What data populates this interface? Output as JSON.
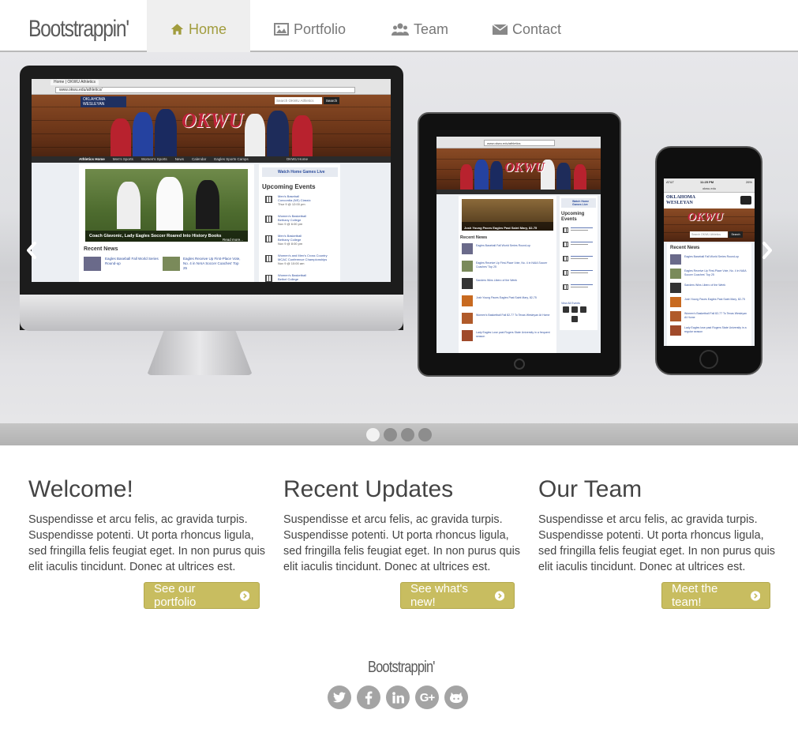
{
  "brand": "Bootstrappin'",
  "nav": {
    "home": "Home",
    "portfolio": "Portfolio",
    "team": "Team",
    "contact": "Contact"
  },
  "carousel": {
    "slides": 4,
    "active_slide": 1
  },
  "devices": {
    "site_logo": "OKWU",
    "monitor": {
      "url": "www.okwu.edu/athletics/",
      "tab_title": "Home | OKWU Athletics",
      "search_placeholder": "Search OKWU Athletics",
      "search_button": "Search",
      "nav_items": [
        "Athletics Home",
        "Men's Sports",
        "Women's Sports",
        "News",
        "Calendar",
        "Eagles Sports Camps",
        "OKWU Home"
      ],
      "caption": "Coach Glavonic, Lady Eagles Soccer Roared Into History Books",
      "read_more": "Read more...",
      "watch_live": "Watch Home Games Live",
      "upcoming": "Upcoming Events",
      "events": [
        {
          "title": "Men's Baseball",
          "detail": "Concordia (NE) Classic",
          "date": "Thur 9 @ 12:00 pm"
        },
        {
          "title": "Women's Basketball",
          "detail": "Bethany College",
          "date": "Nov 9 @ 6:00 pm"
        },
        {
          "title": "Men's Basketball",
          "detail": "Bethany College",
          "date": "Nov 9 @ 8:00 pm"
        },
        {
          "title": "Women's and Men's Cross Country",
          "detail": "MCAC Conference Championships",
          "date": "Nov 9 @ 10:00 am"
        },
        {
          "title": "Women's Basketball",
          "detail": "Bethel College",
          "date": "Nov 9 @ 8:00 pm"
        }
      ],
      "recent_news": "Recent News",
      "news": [
        "Eagles Baseball Fall World Series Round-up",
        "Eagles Receive Up First-Place Vote, No. 4 in NAIA Soccer Coaches' Top 25"
      ]
    },
    "tablet": {
      "url": "www.okwu.edu/athletics",
      "upcoming": "Upcoming Events",
      "watch_live": "Watch Home Games Live",
      "recent_news": "Recent News",
      "caption": "Josh Young Paces Eagles Past Saint Mary, 82-75",
      "news": [
        "Eagles Baseball Fall World Series Round-up",
        "Eagles Receive Up First-Place Vote, No. 4 in NAIA Soccer Coaches' Top 25",
        "Sanders Wins Libero of the Week",
        "Josh Young Paces Eagles Past Saint Mary, 82-75",
        "Women's Basketball Fall 82-77 To Texas Wesleyan At Home",
        "Lady Eagles Lose past Rogers State University in a frequent season"
      ],
      "all_events": "View All Events"
    },
    "phone": {
      "status_carrier": "AT&T",
      "status_time": "11:25 PM",
      "status_battery": "26%",
      "url": "okwu.edu",
      "school_name": "OKLAHOMA WESLEYAN",
      "search_placeholder": "Search OKWU Athletics",
      "search_button": "Search",
      "recent_news": "Recent News",
      "news": [
        "Eagles Baseball Fall World Series Round-up",
        "Eagles Receive Up First-Place Vote, No. 4 in NAIA Soccer Coaches' Top 25",
        "Sanders Wins Libero of the Week",
        "Josh Young Paces Eagles Past Saint Mary, 82-75",
        "Women's Basketball Fall 82-77 To Texas Wesleyan At Home",
        "Lady Eagles lose past Rogers State University in a regular season"
      ]
    }
  },
  "columns": [
    {
      "title": "Welcome!",
      "body": "Suspendisse et arcu felis, ac gravida turpis. Suspendisse potenti. Ut porta rhoncus ligula, sed fringilla felis feugiat eget. In non purus quis elit iaculis tincidunt. Donec at ultrices est.",
      "button": "See our portfolio"
    },
    {
      "title": "Recent Updates",
      "body": "Suspendisse et arcu felis, ac gravida turpis. Suspendisse potenti. Ut porta rhoncus ligula, sed fringilla felis feugiat eget. In non purus quis elit iaculis tincidunt. Donec at ultrices est.",
      "button": "See what's new!"
    },
    {
      "title": "Our Team",
      "body": "Suspendisse et arcu felis, ac gravida turpis. Suspendisse potenti. Ut porta rhoncus ligula, sed fringilla felis feugiat eget. In non purus quis elit iaculis tincidunt. Donec at ultrices est.",
      "button": "Meet the team!"
    }
  ],
  "footer": {
    "brand": "Bootstrappin'",
    "social": [
      "twitter-icon",
      "facebook-icon",
      "linkedin-icon",
      "google-plus-icon",
      "github-icon"
    ]
  },
  "colors": {
    "accent": "#a19c3d",
    "button": "#c8bd60",
    "social": "#a4a4a4"
  }
}
